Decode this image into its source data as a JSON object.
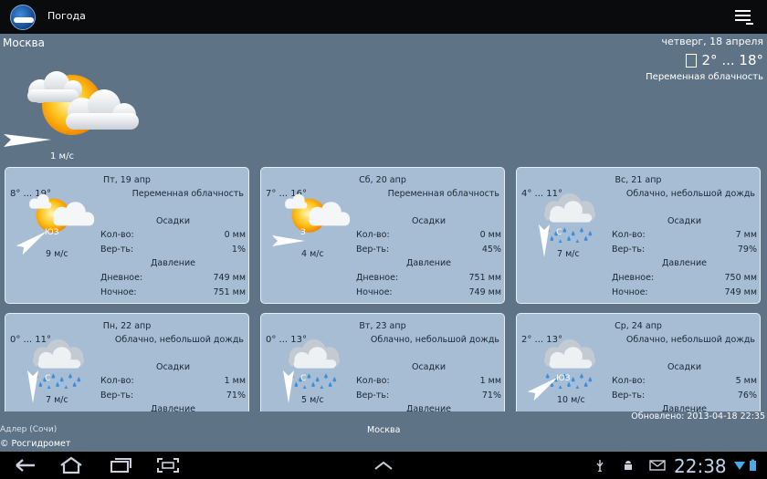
{
  "app": {
    "title": "Погода"
  },
  "current": {
    "city": "Москва",
    "date": "четверг, 18 апреля",
    "temp": "2° ... 18°",
    "condition": "Переменная облачность",
    "wind_speed": "1 м/с"
  },
  "labels": {
    "precip": "Осадки",
    "amount": "Кол-во:",
    "prob": "Вер-ть:",
    "pressure": "Давление",
    "day": "Дневное:",
    "night": "Ночное:"
  },
  "forecast": [
    {
      "day": "Пт, 19 апр",
      "range": "8° ... 19°",
      "cond": "Переменная облачность",
      "icon": "sun-cloud-icon",
      "wdir": "ЮЗ",
      "wspeed": "9 м/с",
      "amount": "0 мм",
      "prob": "1%",
      "pday": "749 мм",
      "pnight": "751 мм"
    },
    {
      "day": "Сб, 20 апр",
      "range": "7° ... 16°",
      "cond": "Переменная облачность",
      "icon": "sun-cloud-icon",
      "wdir": "З",
      "wspeed": "4 м/с",
      "amount": "0 мм",
      "prob": "45%",
      "pday": "751 мм",
      "pnight": "749 мм"
    },
    {
      "day": "Вс, 21 апр",
      "range": "4° ... 11°",
      "cond": "Облачно, небольшой дождь",
      "icon": "rain-cloud-icon",
      "wdir": "С",
      "wspeed": "7 м/с",
      "amount": "7 мм",
      "prob": "79%",
      "pday": "750 мм",
      "pnight": "749 мм"
    },
    {
      "day": "Пн, 22 апр",
      "range": "0° ... 11°",
      "cond": "Облачно, небольшой дождь",
      "icon": "rain-cloud-icon",
      "wdir": "С",
      "wspeed": "7 м/с",
      "amount": "1 мм",
      "prob": "71%",
      "pday": "",
      "pnight": ""
    },
    {
      "day": "Вт, 23 апр",
      "range": "0° ... 13°",
      "cond": "Облачно, небольшой дождь",
      "icon": "rain-cloud-icon",
      "wdir": "С",
      "wspeed": "5 м/с",
      "amount": "1 мм",
      "prob": "71%",
      "pday": "",
      "pnight": ""
    },
    {
      "day": "Ср, 24 апр",
      "range": "2° ... 13°",
      "cond": "Облачно, небольшой дождь",
      "icon": "rain-cloud-icon",
      "wdir": "ЮЗ",
      "wspeed": "10 м/с",
      "amount": "5 мм",
      "prob": "76%",
      "pday": "",
      "pnight": ""
    }
  ],
  "footer": {
    "left_city": "Адлер (Сочи)",
    "center_city": "Москва",
    "updated": "Обновлено: 2013-04-18 22:35",
    "copyright": "© Росгидромет"
  },
  "system": {
    "clock": "22:38"
  }
}
